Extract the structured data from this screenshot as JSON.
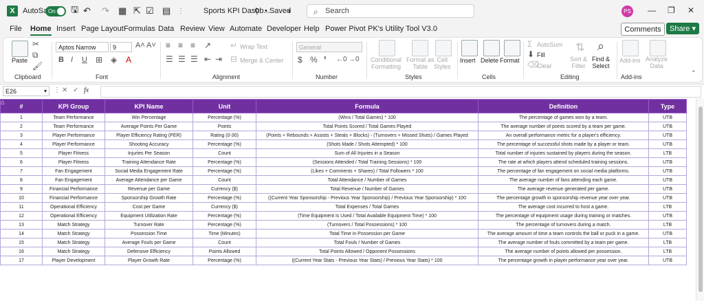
{
  "titlebar": {
    "autosave_label": "AutoSave",
    "autosave_state": "On",
    "file_name": "Sports KPI Dashb...",
    "saved_status": "• Saved",
    "search_placeholder": "Search",
    "user_initials": "PS"
  },
  "menu": {
    "tabs": [
      "File",
      "Home",
      "Insert",
      "Page Layout",
      "Formulas",
      "Data",
      "Review",
      "View",
      "Automate",
      "Developer",
      "Help",
      "Power Pivot",
      "PK's Utility Tool V3.0"
    ],
    "active": "Home",
    "comments_label": "Comments",
    "share_label": "Share"
  },
  "ribbon": {
    "clipboard": {
      "label": "Clipboard",
      "paste": "Paste"
    },
    "font": {
      "label": "Font",
      "font_name": "Aptos Narrow",
      "font_size": "9"
    },
    "alignment": {
      "label": "Alignment",
      "wrap_text": "Wrap Text",
      "merge_center": "Merge & Center"
    },
    "number": {
      "label": "Number",
      "format": "General"
    },
    "styles": {
      "label": "Styles",
      "conditional_1": "Conditional",
      "conditional_2": "Formatting",
      "format_table_1": "Format as",
      "format_table_2": "Table",
      "cell_styles_1": "Cell",
      "cell_styles_2": "Styles"
    },
    "cells": {
      "label": "Cells",
      "insert": "Insert",
      "delete": "Delete",
      "format": "Format"
    },
    "editing": {
      "label": "Editing",
      "autosum": "AutoSum",
      "fill": "Fill",
      "clear": "Clear",
      "sort_1": "Sort &",
      "sort_2": "Filter",
      "find_1": "Find &",
      "find_2": "Select"
    },
    "addins": {
      "label": "Add-ins",
      "addins_btn": "Add-ins",
      "analyze_1": "Analyze",
      "analyze_2": "Data"
    }
  },
  "formula_bar": {
    "cell_ref": "E26",
    "fx": "fx",
    "value": ""
  },
  "sheet": {
    "headers": [
      "#",
      "KPI Group",
      "KPI Name",
      "Unit",
      "Formula",
      "Definition",
      "Type"
    ],
    "rows": [
      [
        "1",
        "Team Performance",
        "Win Percentage",
        "Percentage (%)",
        "(Wins / Total Games) * 100",
        "The percentage of games won by a team.",
        "UTB"
      ],
      [
        "2",
        "Team Performance",
        "Average Points Per Game",
        "Points",
        "Total Points Scored / Total Games Played",
        "The average number of points scored by a team per game.",
        "UTB"
      ],
      [
        "3",
        "Player Performance",
        "Player Efficiency Rating (PER)",
        "Rating (0-30)",
        "(Points + Rebounds + Assists + Steals + Blocks) - (Turnovers + Missed Shots) / Games Played",
        "An overall performance metric for a player's efficiency.",
        "UTB"
      ],
      [
        "4",
        "Player Performance",
        "Shooting Accuracy",
        "Percentage (%)",
        "(Shots Made / Shots Attempted) * 100",
        "The percentage of successful shots made by a player or team.",
        "UTB"
      ],
      [
        "5",
        "Player Fitness",
        "Injuries Per Season",
        "Count",
        "Sum of All Injuries in a Season",
        "Total number of injuries sustained by players during the season.",
        "LTB"
      ],
      [
        "6",
        "Player Fitness",
        "Training Attendance Rate",
        "Percentage (%)",
        "(Sessions Attended / Total Training Sessions) * 100",
        "The rate at which players attend scheduled training sessions.",
        "UTB"
      ],
      [
        "7",
        "Fan Engagement",
        "Social Media Engagement Rate",
        "Percentage (%)",
        "(Likes + Comments + Shares) / Total Followers * 100",
        "The percentage of fan engagement on social media platforms.",
        "UTB"
      ],
      [
        "8",
        "Fan Engagement",
        "Average Attendance per Game",
        "Count",
        "Total Attendance / Number of Games",
        "The average number of fans attending each game.",
        "UTB"
      ],
      [
        "9",
        "Financial Performance",
        "Revenue per Game",
        "Currency ($)",
        "Total Revenue / Number of Games",
        "The average revenue generated per game.",
        "UTB"
      ],
      [
        "10",
        "Financial Performance",
        "Sponsorship Growth Rate",
        "Percentage (%)",
        "((Current Year Sponsorship - Previous Year Sponsorship) / Previous Year Sponsorship) * 100",
        "The percentage growth in sponsorship revenue year over year.",
        "UTB"
      ],
      [
        "11",
        "Operational Efficiency",
        "Cost per Game",
        "Currency ($)",
        "Total Expenses / Total Games",
        "The average cost incurred to host a game.",
        "LTB"
      ],
      [
        "12",
        "Operational Efficiency",
        "Equipment Utilization Rate",
        "Percentage (%)",
        "(Time Equipment is Used / Total Available Equipment Time) * 100",
        "The percentage of equipment usage during training or matches.",
        "UTB"
      ],
      [
        "13",
        "Match Strategy",
        "Turnover Rate",
        "Percentage (%)",
        "(Turnovers / Total Possessions) * 100",
        "The percentage of turnovers during a match.",
        "LTB"
      ],
      [
        "14",
        "Match Strategy",
        "Possession Time",
        "Time (Minutes)",
        "Total Time in Possession per Game",
        "The average amount of time a team controls the ball or puck in a game.",
        "UTB"
      ],
      [
        "15",
        "Match Strategy",
        "Average Fouls per Game",
        "Count",
        "Total Fouls / Number of Games",
        "The average number of fouls committed by a team per game.",
        "LTB"
      ],
      [
        "16",
        "Match Strategy",
        "Defensive Efficiency",
        "Points Allowed",
        "Total Points Allowed / Opponent Possessions",
        "The average number of points allowed per possession.",
        "LTB"
      ],
      [
        "17",
        "Player Development",
        "Player Growth Rate",
        "Percentage (%)",
        "((Current Year Stats - Previous Year Stats) / Previous Year Stats) * 100",
        "The percentage growth in player performance year over year.",
        "UTB"
      ]
    ]
  },
  "colors": {
    "header_bg": "#7030a0",
    "accent": "#1f7a45",
    "avatar": "#d13aa6"
  }
}
